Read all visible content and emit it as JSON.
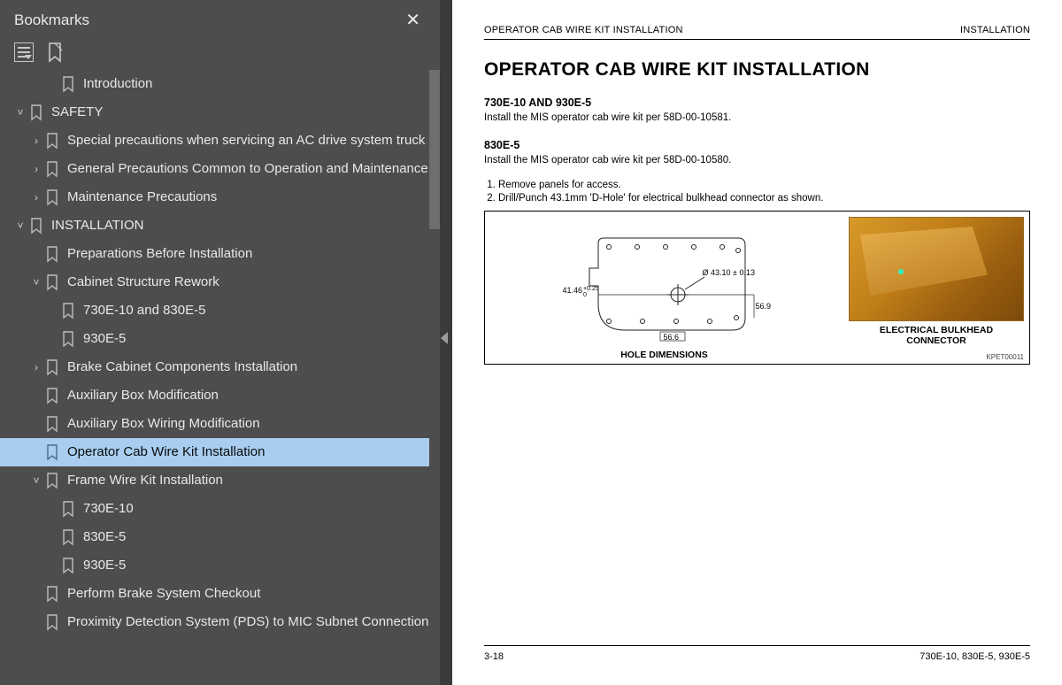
{
  "sidebar": {
    "title": "Bookmarks",
    "tree": [
      {
        "level": 2,
        "chev": "",
        "label": "Introduction"
      },
      {
        "level": 0,
        "chev": "down",
        "label": "SAFETY"
      },
      {
        "level": 1,
        "chev": "right",
        "label": "Special precautions when servicing an AC drive system truck"
      },
      {
        "level": 1,
        "chev": "right",
        "label": "General Precautions Common to Operation and Maintenance"
      },
      {
        "level": 1,
        "chev": "right",
        "label": "Maintenance Precautions"
      },
      {
        "level": 0,
        "chev": "down",
        "label": "INSTALLATION"
      },
      {
        "level": 1,
        "chev": "",
        "label": "Preparations Before Installation"
      },
      {
        "level": 1,
        "chev": "down",
        "label": "Cabinet Structure Rework"
      },
      {
        "level": 2,
        "chev": "",
        "label": "730E-10 and 830E-5"
      },
      {
        "level": 2,
        "chev": "",
        "label": "930E-5"
      },
      {
        "level": 1,
        "chev": "right",
        "label": "Brake Cabinet Components Installation"
      },
      {
        "level": 1,
        "chev": "",
        "label": "Auxiliary Box Modification"
      },
      {
        "level": 1,
        "chev": "",
        "label": "Auxiliary Box Wiring Modification"
      },
      {
        "level": 1,
        "chev": "",
        "label": "Operator Cab Wire Kit Installation",
        "selected": true
      },
      {
        "level": 1,
        "chev": "down",
        "label": "Frame Wire Kit Installation"
      },
      {
        "level": 2,
        "chev": "",
        "label": "730E-10"
      },
      {
        "level": 2,
        "chev": "",
        "label": "830E-5"
      },
      {
        "level": 2,
        "chev": "",
        "label": "930E-5"
      },
      {
        "level": 1,
        "chev": "",
        "label": "Perform Brake System Checkout"
      },
      {
        "level": 1,
        "chev": "",
        "label": "Proximity Detection System (PDS) to MIC Subnet Connection"
      }
    ]
  },
  "doc": {
    "header_left": "OPERATOR CAB WIRE KIT INSTALLATION",
    "header_right": "INSTALLATION",
    "title": "OPERATOR CAB WIRE KIT INSTALLATION",
    "sect1_h": "730E-10 AND 930E-5",
    "sect1_p": "Install the MIS operator cab wire kit per 58D-00-10581.",
    "sect2_h": "830E-5",
    "sect2_p": "Install the MIS operator cab wire kit per 58D-00-10580.",
    "steps": [
      "Remove panels for access.",
      "Drill/Punch 43.1mm 'D-Hole' for electrical bulkhead connector as shown."
    ],
    "dim_diam": "Ø 43.10 ± 0.13",
    "dim_left": "41.46",
    "dim_left_tol_top": "+0.25",
    "dim_left_tol_bot": "0",
    "dim_right": "56.9",
    "dim_bottom": "56.6",
    "fig_left_caption": "HOLE DIMENSIONS",
    "fig_right_caption1": "ELECTRICAL BULKHEAD",
    "fig_right_caption2": "CONNECTOR",
    "fig_ref": "KPET00011",
    "footer_left": "3-18",
    "footer_right": "730E-10, 830E-5, 930E-5"
  }
}
